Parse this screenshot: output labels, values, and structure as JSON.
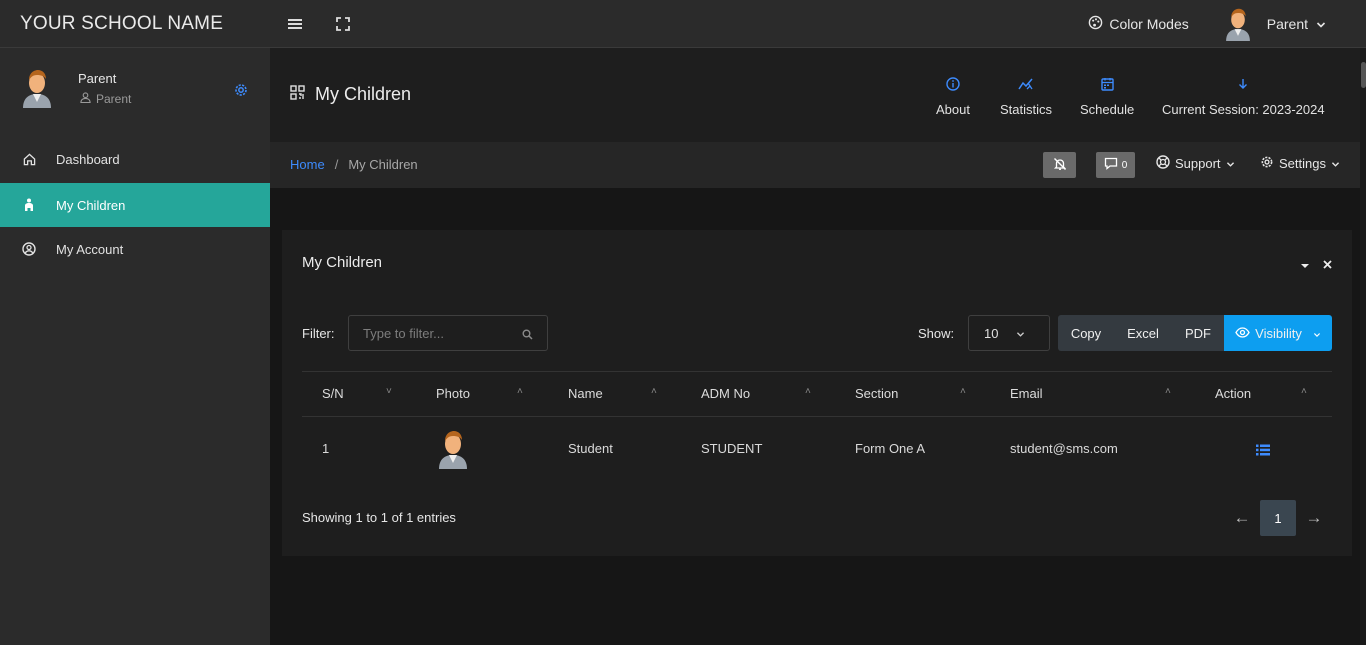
{
  "app": {
    "brand": "YOUR SCHOOL NAME",
    "color_modes_label": "Color Modes",
    "user_label": "Parent"
  },
  "sidebar": {
    "user_name": "Parent",
    "user_role": "Parent",
    "items": [
      {
        "label": "Dashboard",
        "icon": "home-icon",
        "active": false
      },
      {
        "label": "My Children",
        "icon": "child-icon",
        "active": true
      },
      {
        "label": "My Account",
        "icon": "user-circle-icon",
        "active": false
      }
    ]
  },
  "header": {
    "title": "My Children",
    "links": [
      {
        "label": "About",
        "icon": "info-icon"
      },
      {
        "label": "Statistics",
        "icon": "chart-icon"
      },
      {
        "label": "Schedule",
        "icon": "calendar-icon"
      },
      {
        "label": "Current Session: 2023-2024",
        "icon": "arrow-down-icon"
      }
    ]
  },
  "breadcrumb": {
    "home": "Home",
    "separator": "/",
    "current": "My Children"
  },
  "toolbar": {
    "messages_count": "0",
    "support_label": "Support",
    "settings_label": "Settings"
  },
  "card": {
    "title": "My Children",
    "filter_label": "Filter:",
    "filter_placeholder": "Type to filter...",
    "show_label": "Show:",
    "show_value": "10",
    "buttons": {
      "copy": "Copy",
      "excel": "Excel",
      "pdf": "PDF",
      "visibility": "Visibility"
    },
    "columns": [
      "S/N",
      "Photo",
      "Name",
      "ADM No",
      "Section",
      "Email",
      "Action"
    ],
    "rows": [
      {
        "sn": "1",
        "name": "Student",
        "adm_no": "STUDENT",
        "section": "Form One A",
        "email": "student@sms.com"
      }
    ],
    "showing_text": "Showing 1 to 1 of 1 entries",
    "pagination": {
      "prev": "←",
      "page": "1",
      "next": "→"
    }
  },
  "colors": {
    "accent": "#25a69a",
    "link": "#3d8bfd",
    "visibility_button": "#0d9ef0"
  }
}
